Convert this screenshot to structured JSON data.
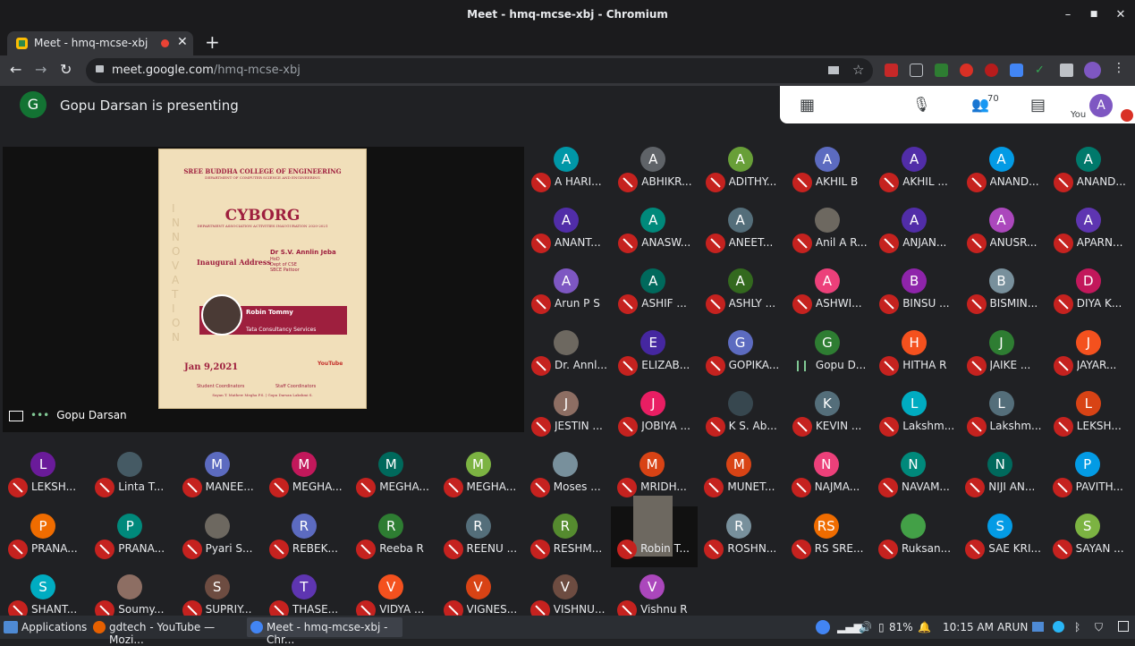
{
  "window": {
    "title": "Meet - hmq-mcse-xbj - Chromium",
    "min": "–",
    "max": "■",
    "close": "✕"
  },
  "tab": {
    "title": "Meet - hmq-mcse-xbj",
    "close": "✕",
    "newtab": "+"
  },
  "nav": {
    "back": "←",
    "forward": "→",
    "reload": "↻"
  },
  "address": {
    "host": "meet.google.com",
    "path": "/hmq-mcse-xbj"
  },
  "meet": {
    "presenter_initial": "G",
    "presenting_text": "Gopu Darsan is presenting",
    "people_count": "70",
    "you_label": "You",
    "you_initial": "A",
    "presentation_label": "Gopu Darsan",
    "presentation_dots": "•••"
  },
  "poster": {
    "college": "SREE BUDDHA COLLEGE OF ENGINEERING",
    "dept": "DEPARTMENT OF COMPUTER SCIENCE AND ENGINEERING",
    "name": "CYBORG",
    "subtitle": "DEPARTMENT ASSOCIATION ACTIVITIES INAUGURATION 2020-2021",
    "inaugural": "Inaugural Address",
    "speaker": "Dr S.V. Annlin Jeba",
    "speaker_role": "HoD",
    "speaker_dept": "Dept of CSE",
    "speaker_college": "SBCE Pattoor",
    "guest": "Robin Tommy",
    "guest_org": "Tata Consultancy Services",
    "date": "Jan 9,2021",
    "student_coord": "Student Coordinators",
    "staff_coord": "Staff Coordinators",
    "names": "Sayan T. Mathew   Megha P.S.   |   Gopu Darsan   Lakshmi S.",
    "side": "INNOVATION",
    "youtube": "YouTube"
  },
  "participants": [
    {
      "i": "A",
      "n": "A HARI...",
      "c": "#0097a7"
    },
    {
      "i": "A",
      "n": "ABHIKR...",
      "c": "#5f6368"
    },
    {
      "i": "A",
      "n": "ADITHY...",
      "c": "#689f38"
    },
    {
      "i": "A",
      "n": "AKHIL B",
      "c": "#5c6bc0"
    },
    {
      "i": "A",
      "n": "AKHIL ...",
      "c": "#512da8"
    },
    {
      "i": "A",
      "n": "ANAND...",
      "c": "#039be5"
    },
    {
      "i": "A",
      "n": "ANAND...",
      "c": "#00796b"
    },
    {
      "i": "A",
      "n": "ANANT...",
      "c": "#512da8"
    },
    {
      "i": "A",
      "n": "ANASW...",
      "c": "#00897b"
    },
    {
      "i": "A",
      "n": "ANEET...",
      "c": "#546e7a"
    },
    {
      "i": "",
      "n": "Anil A R...",
      "c": "#6d6860"
    },
    {
      "i": "A",
      "n": "ANJAN...",
      "c": "#512da8"
    },
    {
      "i": "A",
      "n": "ANUSR...",
      "c": "#ab47bc"
    },
    {
      "i": "A",
      "n": "APARN...",
      "c": "#5e35b1"
    },
    {
      "i": "A",
      "n": "Arun P S",
      "c": "#7e57c2"
    },
    {
      "i": "A",
      "n": "ASHIF ...",
      "c": "#00695c"
    },
    {
      "i": "A",
      "n": "ASHLY ...",
      "c": "#33691e"
    },
    {
      "i": "A",
      "n": "ASHWI...",
      "c": "#ec407a"
    },
    {
      "i": "B",
      "n": "BINSU ...",
      "c": "#8e24aa"
    },
    {
      "i": "B",
      "n": "BISMIN...",
      "c": "#78909c"
    },
    {
      "i": "D",
      "n": "DIYA K...",
      "c": "#c2185b"
    },
    {
      "i": "",
      "n": "Dr. Annl...",
      "c": "#6d6860"
    },
    {
      "i": "E",
      "n": "ELIZAB...",
      "c": "#4527a0"
    },
    {
      "i": "G",
      "n": "GOPIKA...",
      "c": "#5c6bc0"
    },
    {
      "i": "G",
      "n": "Gopu D...",
      "c": "#2e7d32"
    },
    {
      "i": "H",
      "n": "HITHA R",
      "c": "#f4511e"
    },
    {
      "i": "J",
      "n": "JAIKE ...",
      "c": "#2e7d32"
    },
    {
      "i": "J",
      "n": "JAYAR...",
      "c": "#f4511e"
    },
    {
      "i": "J",
      "n": "JESTIN ...",
      "c": "#8d6e63"
    },
    {
      "i": "J",
      "n": "JOBIYA ...",
      "c": "#e91e63"
    },
    {
      "i": "",
      "n": "K S. Ab...",
      "c": "#37474f"
    },
    {
      "i": "K",
      "n": "KEVIN ...",
      "c": "#546e7a"
    },
    {
      "i": "L",
      "n": "Lakshm...",
      "c": "#00acc1"
    },
    {
      "i": "L",
      "n": "Lakshm...",
      "c": "#546e7a"
    },
    {
      "i": "L",
      "n": "LEKSH...",
      "c": "#d84315"
    },
    {
      "i": "L",
      "n": "LEKSH...",
      "c": "#6a1b9a"
    },
    {
      "i": "",
      "n": "Linta T...",
      "c": "#455a64"
    },
    {
      "i": "M",
      "n": "MANEE...",
      "c": "#5c6bc0"
    },
    {
      "i": "M",
      "n": "MEGHA...",
      "c": "#c2185b"
    },
    {
      "i": "M",
      "n": "MEGHA...",
      "c": "#00695c"
    },
    {
      "i": "M",
      "n": "MEGHA...",
      "c": "#7cb342"
    },
    {
      "i": "",
      "n": "Moses ...",
      "c": "#78909c"
    },
    {
      "i": "M",
      "n": "MRIDH...",
      "c": "#d84315"
    },
    {
      "i": "M",
      "n": "MUNET...",
      "c": "#d84315"
    },
    {
      "i": "N",
      "n": "NAJMA...",
      "c": "#ec407a"
    },
    {
      "i": "N",
      "n": "NAVAM...",
      "c": "#00897b"
    },
    {
      "i": "N",
      "n": "NIJI AN...",
      "c": "#00695c"
    },
    {
      "i": "P",
      "n": "PAVITH...",
      "c": "#039be5"
    },
    {
      "i": "P",
      "n": "PRANA...",
      "c": "#ef6c00"
    },
    {
      "i": "P",
      "n": "PRANA...",
      "c": "#00897b"
    },
    {
      "i": "",
      "n": "Pyari S...",
      "c": "#6d6860"
    },
    {
      "i": "R",
      "n": "REBEK...",
      "c": "#5c6bc0"
    },
    {
      "i": "R",
      "n": "Reeba R",
      "c": "#2e7d32"
    },
    {
      "i": "R",
      "n": "REENU ...",
      "c": "#546e7a"
    },
    {
      "i": "R",
      "n": "RESHM...",
      "c": "#558b2f"
    },
    {
      "i": "",
      "n": "Robin T...",
      "c": "#6d6860"
    },
    {
      "i": "R",
      "n": "ROSHN...",
      "c": "#78909c"
    },
    {
      "i": "RS",
      "n": "RS SRE...",
      "c": "#ef6c00"
    },
    {
      "i": "",
      "n": "Ruksan...",
      "c": "#43a047"
    },
    {
      "i": "S",
      "n": "SAE KRI...",
      "c": "#039be5"
    },
    {
      "i": "S",
      "n": "SAYAN ...",
      "c": "#7cb342"
    },
    {
      "i": "S",
      "n": "SHANT...",
      "c": "#00acc1"
    },
    {
      "i": "",
      "n": "Soumy...",
      "c": "#8d6e63"
    },
    {
      "i": "S",
      "n": "SUPRIY...",
      "c": "#6d4c41"
    },
    {
      "i": "T",
      "n": "THASE...",
      "c": "#5e35b1"
    },
    {
      "i": "V",
      "n": "VIDYA ...",
      "c": "#f4511e"
    },
    {
      "i": "V",
      "n": "VIGNES...",
      "c": "#d84315"
    },
    {
      "i": "V",
      "n": "VISHNU...",
      "c": "#6d4c41"
    },
    {
      "i": "V",
      "n": "Vishnu R",
      "c": "#ab47bc"
    }
  ],
  "taskbar": {
    "apps": "Applications",
    "task1": "gdtech - YouTube — Mozi...",
    "task2": "Meet - hmq-mcse-xbj - Chr...",
    "battery": "81%",
    "time": "10:15 AM",
    "user": "ARUN"
  }
}
